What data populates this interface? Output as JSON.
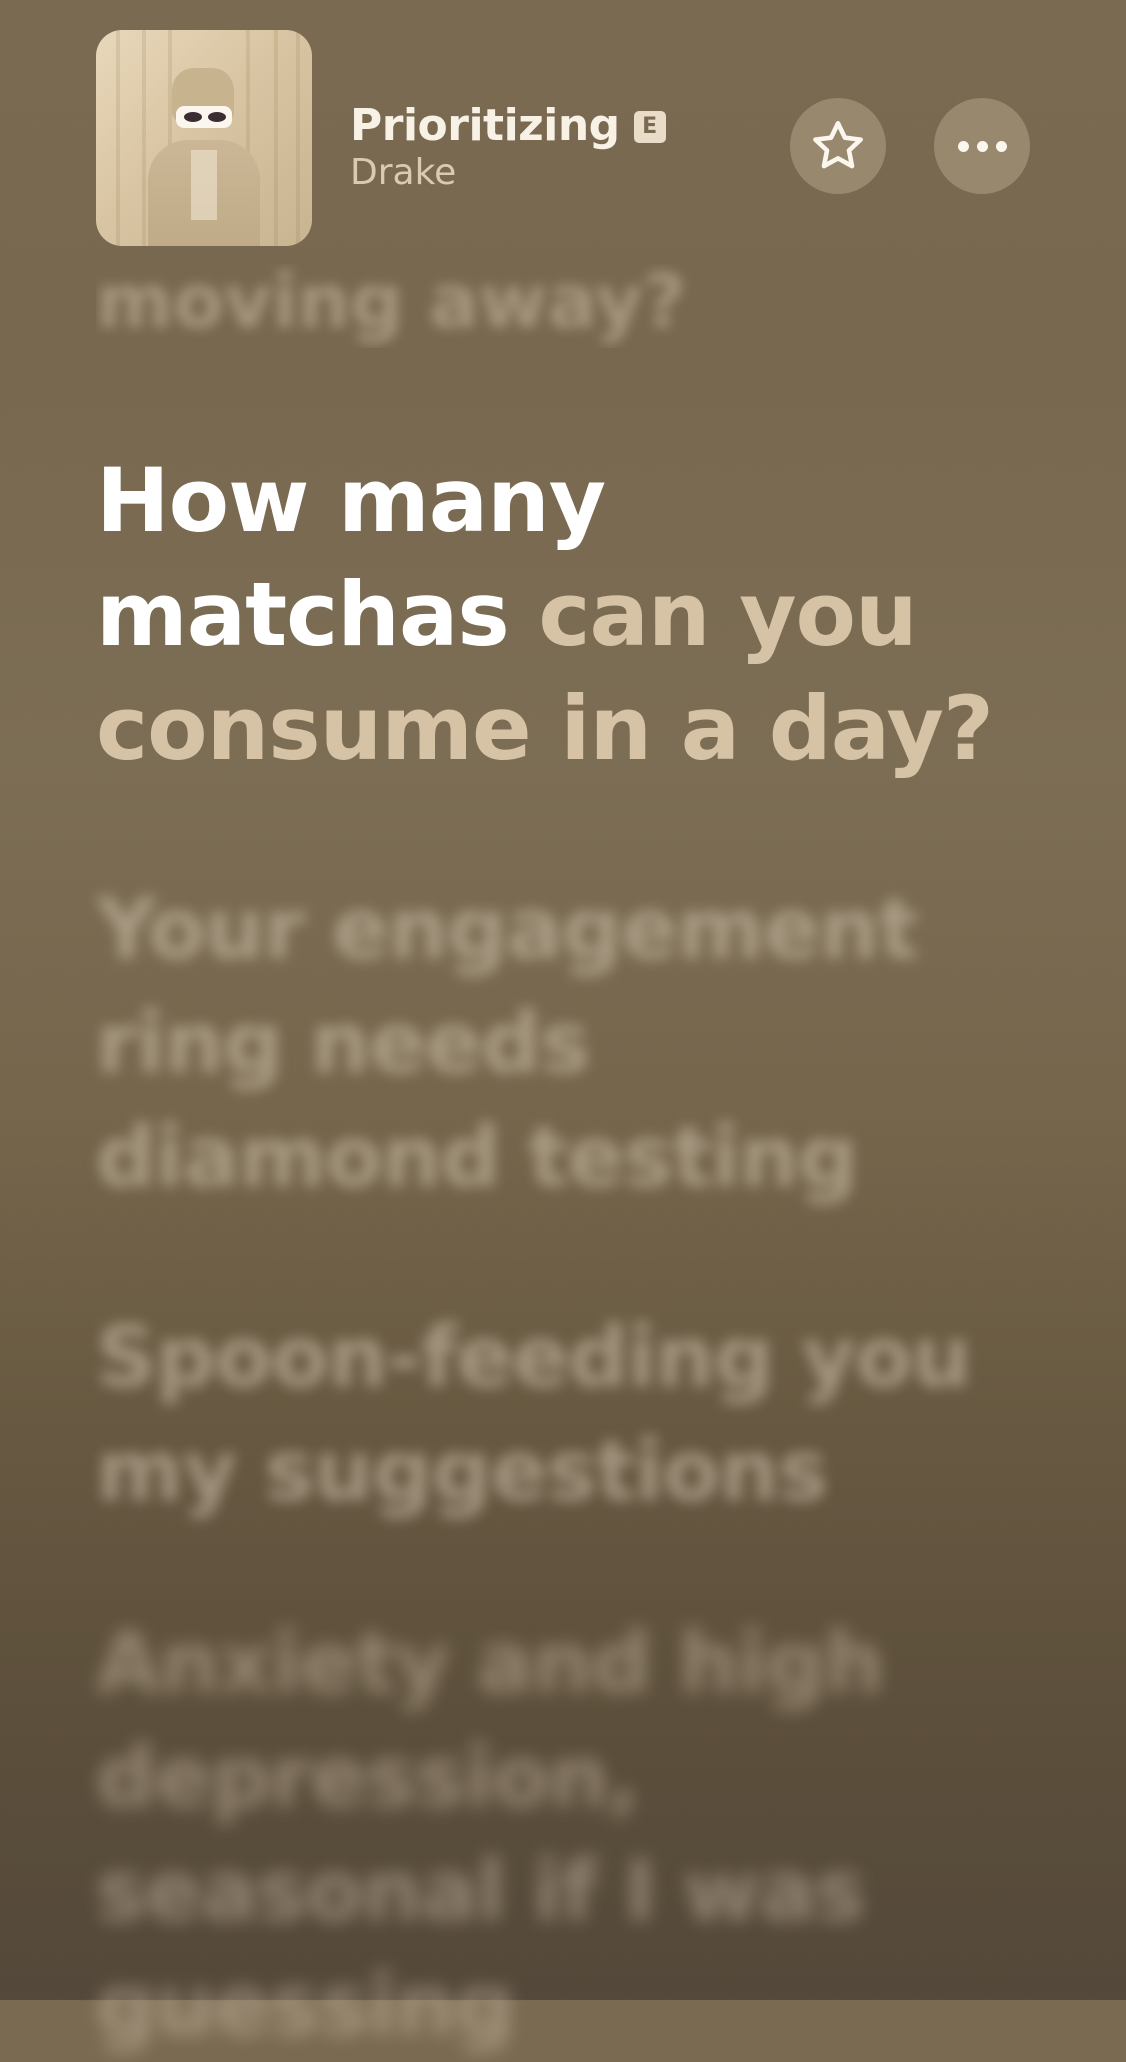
{
  "now_playing": {
    "title": "Prioritizing",
    "explicit_badge": "E",
    "artist": "Drake",
    "album_art_icon": "album-art"
  },
  "actions": {
    "favorite_icon": "star-icon",
    "more_icon": "ellipsis-icon"
  },
  "lyrics": {
    "previous_line": "moving away?",
    "current_line": {
      "sung": "How many matchas",
      "unsung": "can you consume in a day?"
    },
    "upcoming_lines": [
      "Your engagement ring needs diamond testing",
      "Spoon-feeding you my suggestions",
      "Anxiety and high depression, seasonal if I was guessing"
    ]
  },
  "colors": {
    "background_top": "#7a6a52",
    "background_bottom": "#54483a",
    "lyric_active": "#ffffff",
    "lyric_inactive": "#d6c3a6"
  }
}
